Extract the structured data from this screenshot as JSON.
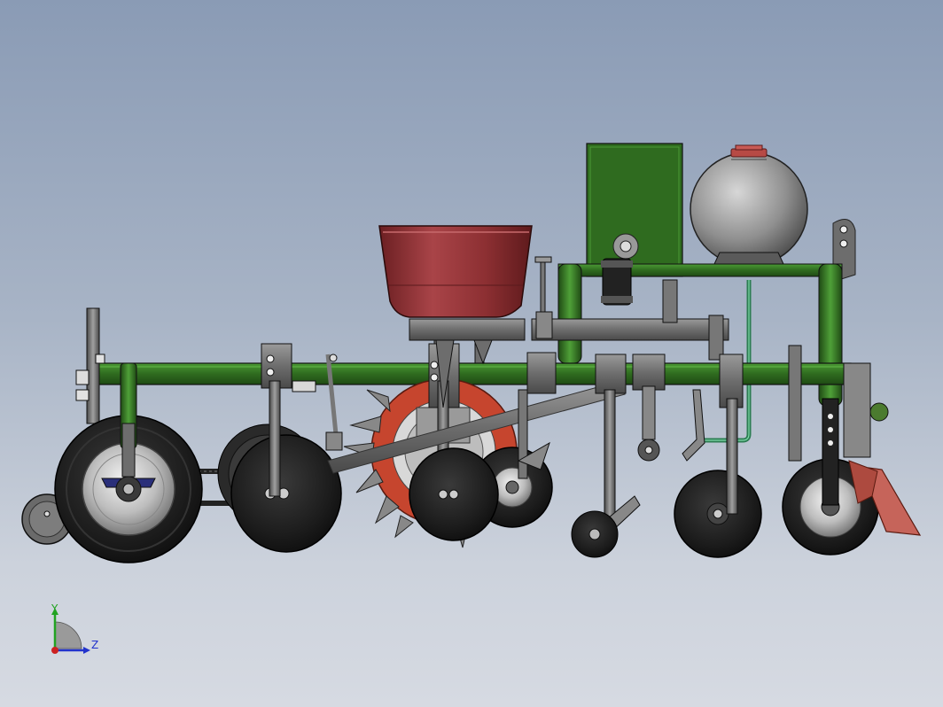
{
  "view": {
    "background_top": "#8a9bb5",
    "background_bottom": "#d6dae2"
  },
  "colors": {
    "frame_green": "#2f6b1f",
    "frame_green_light": "#4b9a35",
    "hopper_red": "#8c2f32",
    "hopper_red_light": "#a94448",
    "disc_orange": "#c6452e",
    "tire_black": "#1c1c1c",
    "steel_gray": "#6d6d6d",
    "tank_gray": "#8f8f8f",
    "axis_y": "#22a322",
    "axis_z": "#2233cc",
    "axis_x": "#cc2222"
  },
  "triad": {
    "y_label": "Y",
    "z_label": "Z",
    "x_icon": "x-axis-icon"
  }
}
